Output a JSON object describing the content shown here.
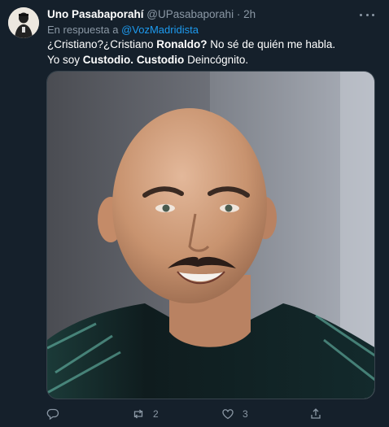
{
  "tweet": {
    "author_name": "Uno Pasabaporahí",
    "handle": "@UPasabaporahi",
    "separator": "·",
    "time": "2h",
    "reply_prefix": "En respuesta a",
    "reply_to": "@VozMadridista",
    "text_line1_a": "¿Cristiano?¿Cristiano ",
    "text_line1_b": "Ronaldo?",
    "text_line1_c": " No sé de quién me habla.",
    "text_line2_a": "Yo soy ",
    "text_line2_b": "Custodio.",
    "text_line2_c": " ",
    "text_line2_d": "Custodio",
    "text_line2_e": " Deincógnito."
  },
  "actions": {
    "reply": {
      "icon": "reply-icon",
      "count": ""
    },
    "retweet": {
      "icon": "retweet-icon",
      "count": "2"
    },
    "like": {
      "icon": "like-icon",
      "count": "3"
    },
    "share": {
      "icon": "share-icon",
      "count": ""
    }
  },
  "colors": {
    "background": "#15202b",
    "text": "#ffffff",
    "secondary": "#8b98a5",
    "accent": "#1d9bf0"
  }
}
